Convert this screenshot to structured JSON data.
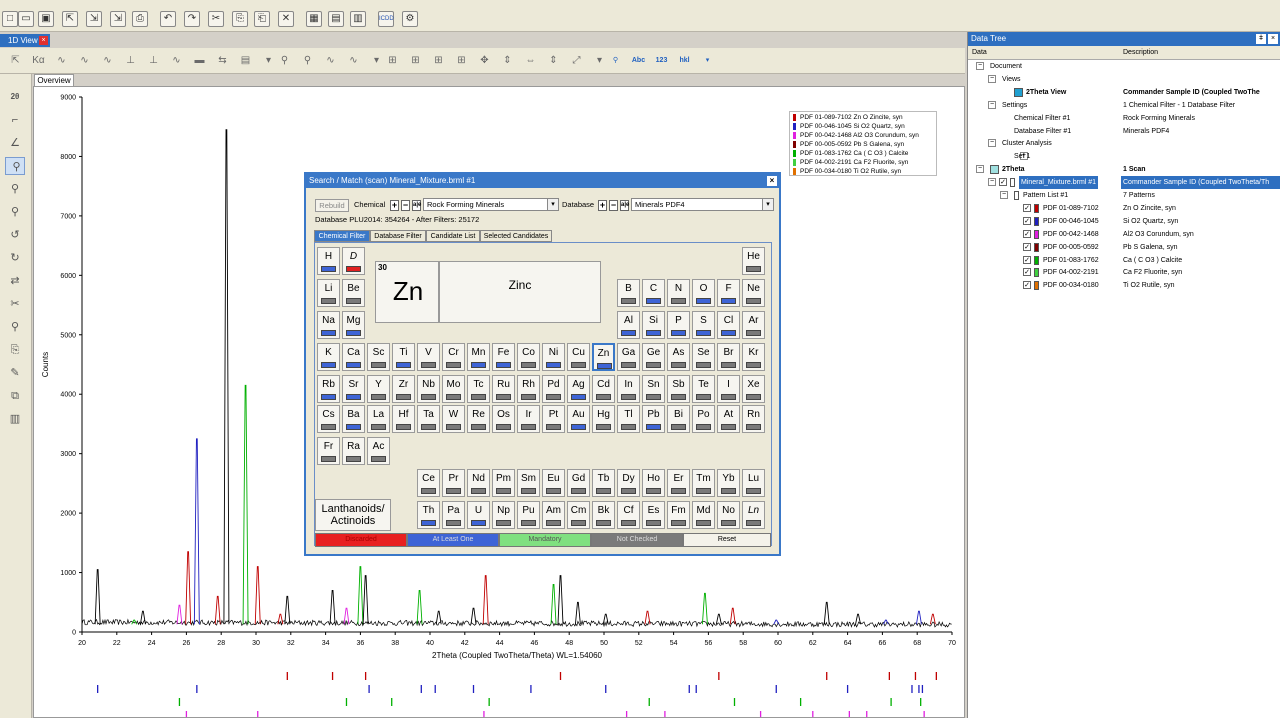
{
  "toolbar": {
    "icons": [
      "new-icon",
      "open-icon",
      "save-icon",
      "export-icon",
      "import-icon",
      "import-multi-icon",
      "print-icon",
      "undo-icon",
      "redo-icon",
      "cut-icon",
      "copy-icon",
      "paste-icon",
      "delete-icon",
      "view1-icon",
      "view2-icon",
      "view3-icon",
      "icdd-icon",
      "settings-icon"
    ],
    "icdd_label": "ICDD"
  },
  "view_tab": {
    "label": "1D View"
  },
  "overview_tab": {
    "label": "Overview"
  },
  "chart_data": {
    "type": "line",
    "xlabel": "2Theta (Coupled TwoTheta/Theta) WL=1.54060",
    "ylabel": "Counts",
    "xlim": [
      20,
      70
    ],
    "ylim": [
      0,
      9000
    ],
    "x_ticks": [
      "20",
      "22",
      "24",
      "26",
      "28",
      "30",
      "32",
      "34",
      "36",
      "38",
      "40",
      "42",
      "44",
      "46",
      "48",
      "50",
      "52",
      "54",
      "56",
      "58",
      "60",
      "62",
      "64",
      "66",
      "68",
      "70"
    ],
    "y_ticks": [
      "0",
      "1000",
      "2000",
      "3000",
      "4000",
      "5000",
      "6000",
      "7000",
      "8000",
      "9000"
    ],
    "peaks": [
      {
        "x": 20.9,
        "y": 1050,
        "color": "#000000"
      },
      {
        "x": 23.0,
        "y": 200,
        "color": "#00b000"
      },
      {
        "x": 23.5,
        "y": 350,
        "color": "#000000"
      },
      {
        "x": 25.6,
        "y": 450,
        "color": "#e020e0"
      },
      {
        "x": 26.1,
        "y": 1350,
        "color": "#c00000"
      },
      {
        "x": 26.6,
        "y": 3250,
        "color": "#2020c0"
      },
      {
        "x": 27.8,
        "y": 600,
        "color": "#c00000"
      },
      {
        "x": 28.3,
        "y": 8450,
        "color": "#000000"
      },
      {
        "x": 29.4,
        "y": 4150,
        "color": "#00b000"
      },
      {
        "x": 30.1,
        "y": 1100,
        "color": "#c00000"
      },
      {
        "x": 31.4,
        "y": 300,
        "color": "#c00000"
      },
      {
        "x": 31.8,
        "y": 600,
        "color": "#000000"
      },
      {
        "x": 34.4,
        "y": 700,
        "color": "#000000"
      },
      {
        "x": 35.2,
        "y": 400,
        "color": "#e020e0"
      },
      {
        "x": 36.0,
        "y": 1100,
        "color": "#00b000"
      },
      {
        "x": 36.3,
        "y": 950,
        "color": "#000000"
      },
      {
        "x": 39.4,
        "y": 700,
        "color": "#00b000"
      },
      {
        "x": 40.5,
        "y": 350,
        "color": "#000000"
      },
      {
        "x": 42.5,
        "y": 400,
        "color": "#000000"
      },
      {
        "x": 43.2,
        "y": 950,
        "color": "#c00000"
      },
      {
        "x": 47.1,
        "y": 800,
        "color": "#00b000"
      },
      {
        "x": 47.5,
        "y": 950,
        "color": "#000000"
      },
      {
        "x": 48.5,
        "y": 500,
        "color": "#000000"
      },
      {
        "x": 50.1,
        "y": 300,
        "color": "#000000"
      },
      {
        "x": 52.5,
        "y": 350,
        "color": "#c00000"
      },
      {
        "x": 55.8,
        "y": 650,
        "color": "#00b000"
      },
      {
        "x": 56.6,
        "y": 300,
        "color": "#000000"
      },
      {
        "x": 57.4,
        "y": 400,
        "color": "#c00000"
      },
      {
        "x": 59.9,
        "y": 200,
        "color": "#2020c0"
      },
      {
        "x": 62.8,
        "y": 500,
        "color": "#000000"
      },
      {
        "x": 64.6,
        "y": 300,
        "color": "#000000"
      },
      {
        "x": 66.2,
        "y": 200,
        "color": "#2020c0"
      },
      {
        "x": 68.1,
        "y": 350,
        "color": "#2020c0"
      },
      {
        "x": 68.9,
        "y": 300,
        "color": "#c00000"
      }
    ],
    "stick_patterns": [
      {
        "color": "#c00000",
        "x": [
          31.8,
          34.4,
          36.3,
          47.5,
          56.6,
          62.8,
          66.4,
          67.9,
          69.1
        ]
      },
      {
        "color": "#2020c0",
        "x": [
          20.9,
          26.6,
          36.5,
          39.5,
          40.3,
          42.5,
          45.8,
          50.1,
          54.9,
          55.3,
          59.9,
          64.0,
          67.7,
          68.1,
          68.3
        ]
      },
      {
        "color": "#00b000",
        "x": [
          25.6,
          35.2,
          37.8,
          43.4,
          52.6,
          57.5,
          61.3,
          66.5,
          68.2
        ]
      },
      {
        "color": "#e020e0",
        "x": [
          26.0,
          30.1,
          43.1,
          51.3,
          53.5,
          59.0,
          62.0,
          64.1,
          65.1,
          68.4
        ]
      },
      {
        "color": "#c00000",
        "x": [
          23.1,
          29.4,
          36.0,
          39.4,
          43.2,
          47.1,
          47.5,
          48.5,
          57.4,
          60.7,
          61.4,
          64.7,
          65.6,
          69.2
        ]
      },
      {
        "color": "#e07000",
        "x": [
          28.3,
          47.0,
          55.8,
          58.6,
          69.5
        ]
      }
    ],
    "legend": [
      {
        "label": "PDF 01-089-7102 Zn O Zincite, syn",
        "color": "#c00000"
      },
      {
        "label": "PDF 00-046-1045 Si O2 Quartz, syn",
        "color": "#2020c0"
      },
      {
        "label": "PDF 00-042-1468 Al2 O3 Corundum, syn",
        "color": "#e020e0"
      },
      {
        "label": "PDF 00-005-0592 Pb S Galena, syn",
        "color": "#800000"
      },
      {
        "label": "PDF 01-083-1762 Ca ( C O3 ) Calcite",
        "color": "#00b000"
      },
      {
        "label": "PDF 04-002-2191 Ca F2 Fluorite, syn",
        "color": "#40d040"
      },
      {
        "label": "PDF 00-034-0180 Ti O2 Rutile, syn",
        "color": "#e07000"
      }
    ]
  },
  "datatree": {
    "title": "Data Tree",
    "col_data": "Data",
    "col_desc": "Description",
    "rows": [
      {
        "label": "Document",
        "desc": "",
        "indent": 0
      },
      {
        "label": "Views",
        "desc": "",
        "indent": 1
      },
      {
        "label": "2Theta View",
        "desc": "Commander Sample ID (Coupled TwoThe",
        "indent": 2,
        "bold": true
      },
      {
        "label": "Settings",
        "desc": "1 Chemical Filter - 1 Database Filter",
        "indent": 1
      },
      {
        "label": "Chemical Filter #1",
        "desc": "Rock Forming Minerals",
        "indent": 2
      },
      {
        "label": "Database Filter #1",
        "desc": "Minerals PDF4",
        "indent": 2
      },
      {
        "label": "Cluster Analysis",
        "desc": "",
        "indent": 1
      },
      {
        "label": "Set 1",
        "desc": "",
        "indent": 2
      },
      {
        "label": "2Theta",
        "desc": "1 Scan",
        "indent": 0,
        "bold": true
      },
      {
        "label": "Mineral_Mixture.brml #1",
        "desc": "Commander Sample ID (Coupled TwoTheta/Th",
        "indent": 1,
        "hl": true
      },
      {
        "label": "Pattern List #1",
        "desc": "7 Patterns",
        "indent": 2
      },
      {
        "label": "PDF 01-089-7102",
        "desc": "Zn O Zincite, syn",
        "indent": 3,
        "color": "#c00000"
      },
      {
        "label": "PDF 00-046-1045",
        "desc": "Si O2 Quartz, syn",
        "indent": 3,
        "color": "#2020c0"
      },
      {
        "label": "PDF 00-042-1468",
        "desc": "Al2 O3 Corundum, syn",
        "indent": 3,
        "color": "#e020e0"
      },
      {
        "label": "PDF 00-005-0592",
        "desc": "Pb S Galena, syn",
        "indent": 3,
        "color": "#800000"
      },
      {
        "label": "PDF 01-083-1762",
        "desc": "Ca ( C O3 ) Calcite",
        "indent": 3,
        "color": "#00b000"
      },
      {
        "label": "PDF 04-002-2191",
        "desc": "Ca F2 Fluorite, syn",
        "indent": 3,
        "color": "#40d040"
      },
      {
        "label": "PDF 00-034-0180",
        "desc": "Ti O2 Rutile, syn",
        "indent": 3,
        "color": "#e07000"
      }
    ]
  },
  "dialog": {
    "title": "Search / Match (scan) Mineral_Mixture.brml #1",
    "rebuild": "Rebuild",
    "chemical_label": "Chemical",
    "chemical_value": "Rock Forming Minerals",
    "database_label": "Database",
    "database_value": "Minerals PDF4",
    "db_info": "Database PLU2014: 354264 - After Filters: 25172",
    "tabs": [
      "Chemical Filter",
      "Database Filter",
      "Candidate List",
      "Selected Candidates"
    ],
    "selected_element": {
      "number": "30",
      "symbol": "Zn",
      "name": "Zinc"
    },
    "lanthanoids": "Lanthanoids/ Actinoids",
    "legend": [
      {
        "label": "Discarded",
        "color": "#e82020"
      },
      {
        "label": "At Least One",
        "color": "#3e64d6"
      },
      {
        "label": "Mandatory",
        "color": "#80e080"
      },
      {
        "label": "Not Checked",
        "color": "#7a7a7a"
      }
    ],
    "reset": "Reset",
    "elements": [
      {
        "s": "H",
        "r": 0,
        "c": 0,
        "st": "b"
      },
      {
        "s": "D",
        "r": 0,
        "c": 1,
        "st": "r",
        "it": true
      },
      {
        "s": "He",
        "r": 0,
        "c": 17,
        "st": "g"
      },
      {
        "s": "Li",
        "r": 1,
        "c": 0,
        "st": "g"
      },
      {
        "s": "Be",
        "r": 1,
        "c": 1,
        "st": "g"
      },
      {
        "s": "B",
        "r": 1,
        "c": 12,
        "st": "g"
      },
      {
        "s": "C",
        "r": 1,
        "c": 13,
        "st": "b"
      },
      {
        "s": "N",
        "r": 1,
        "c": 14,
        "st": "g"
      },
      {
        "s": "O",
        "r": 1,
        "c": 15,
        "st": "b"
      },
      {
        "s": "F",
        "r": 1,
        "c": 16,
        "st": "b"
      },
      {
        "s": "Ne",
        "r": 1,
        "c": 17,
        "st": "g"
      },
      {
        "s": "Na",
        "r": 2,
        "c": 0,
        "st": "b"
      },
      {
        "s": "Mg",
        "r": 2,
        "c": 1,
        "st": "b"
      },
      {
        "s": "Al",
        "r": 2,
        "c": 12,
        "st": "b"
      },
      {
        "s": "Si",
        "r": 2,
        "c": 13,
        "st": "b"
      },
      {
        "s": "P",
        "r": 2,
        "c": 14,
        "st": "b"
      },
      {
        "s": "S",
        "r": 2,
        "c": 15,
        "st": "b"
      },
      {
        "s": "Cl",
        "r": 2,
        "c": 16,
        "st": "b"
      },
      {
        "s": "Ar",
        "r": 2,
        "c": 17,
        "st": "g"
      },
      {
        "s": "K",
        "r": 3,
        "c": 0,
        "st": "b"
      },
      {
        "s": "Ca",
        "r": 3,
        "c": 1,
        "st": "b"
      },
      {
        "s": "Sc",
        "r": 3,
        "c": 2,
        "st": "g"
      },
      {
        "s": "Ti",
        "r": 3,
        "c": 3,
        "st": "b"
      },
      {
        "s": "V",
        "r": 3,
        "c": 4,
        "st": "g"
      },
      {
        "s": "Cr",
        "r": 3,
        "c": 5,
        "st": "g"
      },
      {
        "s": "Mn",
        "r": 3,
        "c": 6,
        "st": "b"
      },
      {
        "s": "Fe",
        "r": 3,
        "c": 7,
        "st": "b"
      },
      {
        "s": "Co",
        "r": 3,
        "c": 8,
        "st": "g"
      },
      {
        "s": "Ni",
        "r": 3,
        "c": 9,
        "st": "b"
      },
      {
        "s": "Cu",
        "r": 3,
        "c": 10,
        "st": "g"
      },
      {
        "s": "Zn",
        "r": 3,
        "c": 11,
        "st": "b",
        "zn": true
      },
      {
        "s": "Ga",
        "r": 3,
        "c": 12,
        "st": "g"
      },
      {
        "s": "Ge",
        "r": 3,
        "c": 13,
        "st": "g"
      },
      {
        "s": "As",
        "r": 3,
        "c": 14,
        "st": "g"
      },
      {
        "s": "Se",
        "r": 3,
        "c": 15,
        "st": "g"
      },
      {
        "s": "Br",
        "r": 3,
        "c": 16,
        "st": "g"
      },
      {
        "s": "Kr",
        "r": 3,
        "c": 17,
        "st": "g"
      },
      {
        "s": "Rb",
        "r": 4,
        "c": 0,
        "st": "b"
      },
      {
        "s": "Sr",
        "r": 4,
        "c": 1,
        "st": "b"
      },
      {
        "s": "Y",
        "r": 4,
        "c": 2,
        "st": "g"
      },
      {
        "s": "Zr",
        "r": 4,
        "c": 3,
        "st": "g"
      },
      {
        "s": "Nb",
        "r": 4,
        "c": 4,
        "st": "g"
      },
      {
        "s": "Mo",
        "r": 4,
        "c": 5,
        "st": "g"
      },
      {
        "s": "Tc",
        "r": 4,
        "c": 6,
        "st": "g"
      },
      {
        "s": "Ru",
        "r": 4,
        "c": 7,
        "st": "g"
      },
      {
        "s": "Rh",
        "r": 4,
        "c": 8,
        "st": "g"
      },
      {
        "s": "Pd",
        "r": 4,
        "c": 9,
        "st": "g"
      },
      {
        "s": "Ag",
        "r": 4,
        "c": 10,
        "st": "b"
      },
      {
        "s": "Cd",
        "r": 4,
        "c": 11,
        "st": "g"
      },
      {
        "s": "In",
        "r": 4,
        "c": 12,
        "st": "g"
      },
      {
        "s": "Sn",
        "r": 4,
        "c": 13,
        "st": "g"
      },
      {
        "s": "Sb",
        "r": 4,
        "c": 14,
        "st": "g"
      },
      {
        "s": "Te",
        "r": 4,
        "c": 15,
        "st": "g"
      },
      {
        "s": "I",
        "r": 4,
        "c": 16,
        "st": "g"
      },
      {
        "s": "Xe",
        "r": 4,
        "c": 17,
        "st": "g"
      },
      {
        "s": "Cs",
        "r": 5,
        "c": 0,
        "st": "g"
      },
      {
        "s": "Ba",
        "r": 5,
        "c": 1,
        "st": "b"
      },
      {
        "s": "La",
        "r": 5,
        "c": 2,
        "st": "g"
      },
      {
        "s": "Hf",
        "r": 5,
        "c": 3,
        "st": "g"
      },
      {
        "s": "Ta",
        "r": 5,
        "c": 4,
        "st": "g"
      },
      {
        "s": "W",
        "r": 5,
        "c": 5,
        "st": "g"
      },
      {
        "s": "Re",
        "r": 5,
        "c": 6,
        "st": "g"
      },
      {
        "s": "Os",
        "r": 5,
        "c": 7,
        "st": "g"
      },
      {
        "s": "Ir",
        "r": 5,
        "c": 8,
        "st": "g"
      },
      {
        "s": "Pt",
        "r": 5,
        "c": 9,
        "st": "g"
      },
      {
        "s": "Au",
        "r": 5,
        "c": 10,
        "st": "b"
      },
      {
        "s": "Hg",
        "r": 5,
        "c": 11,
        "st": "g"
      },
      {
        "s": "Tl",
        "r": 5,
        "c": 12,
        "st": "g"
      },
      {
        "s": "Pb",
        "r": 5,
        "c": 13,
        "st": "b"
      },
      {
        "s": "Bi",
        "r": 5,
        "c": 14,
        "st": "g"
      },
      {
        "s": "Po",
        "r": 5,
        "c": 15,
        "st": "g"
      },
      {
        "s": "At",
        "r": 5,
        "c": 16,
        "st": "g"
      },
      {
        "s": "Rn",
        "r": 5,
        "c": 17,
        "st": "g"
      },
      {
        "s": "Fr",
        "r": 6,
        "c": 0,
        "st": "g"
      },
      {
        "s": "Ra",
        "r": 6,
        "c": 1,
        "st": "g"
      },
      {
        "s": "Ac",
        "r": 6,
        "c": 2,
        "st": "g"
      },
      {
        "s": "Ce",
        "r": 7,
        "c": 4,
        "st": "g"
      },
      {
        "s": "Pr",
        "r": 7,
        "c": 5,
        "st": "g"
      },
      {
        "s": "Nd",
        "r": 7,
        "c": 6,
        "st": "g"
      },
      {
        "s": "Pm",
        "r": 7,
        "c": 7,
        "st": "g"
      },
      {
        "s": "Sm",
        "r": 7,
        "c": 8,
        "st": "g"
      },
      {
        "s": "Eu",
        "r": 7,
        "c": 9,
        "st": "g"
      },
      {
        "s": "Gd",
        "r": 7,
        "c": 10,
        "st": "g"
      },
      {
        "s": "Tb",
        "r": 7,
        "c": 11,
        "st": "g"
      },
      {
        "s": "Dy",
        "r": 7,
        "c": 12,
        "st": "g"
      },
      {
        "s": "Ho",
        "r": 7,
        "c": 13,
        "st": "g"
      },
      {
        "s": "Er",
        "r": 7,
        "c": 14,
        "st": "g"
      },
      {
        "s": "Tm",
        "r": 7,
        "c": 15,
        "st": "g"
      },
      {
        "s": "Yb",
        "r": 7,
        "c": 16,
        "st": "g"
      },
      {
        "s": "Lu",
        "r": 7,
        "c": 17,
        "st": "g"
      },
      {
        "s": "Th",
        "r": 8,
        "c": 4,
        "st": "b"
      },
      {
        "s": "Pa",
        "r": 8,
        "c": 5,
        "st": "g"
      },
      {
        "s": "U",
        "r": 8,
        "c": 6,
        "st": "b"
      },
      {
        "s": "Np",
        "r": 8,
        "c": 7,
        "st": "g"
      },
      {
        "s": "Pu",
        "r": 8,
        "c": 8,
        "st": "g"
      },
      {
        "s": "Am",
        "r": 8,
        "c": 9,
        "st": "g"
      },
      {
        "s": "Cm",
        "r": 8,
        "c": 10,
        "st": "g"
      },
      {
        "s": "Bk",
        "r": 8,
        "c": 11,
        "st": "g"
      },
      {
        "s": "Cf",
        "r": 8,
        "c": 12,
        "st": "g"
      },
      {
        "s": "Es",
        "r": 8,
        "c": 13,
        "st": "g"
      },
      {
        "s": "Fm",
        "r": 8,
        "c": 14,
        "st": "g"
      },
      {
        "s": "Md",
        "r": 8,
        "c": 15,
        "st": "g"
      },
      {
        "s": "No",
        "r": 8,
        "c": 16,
        "st": "g"
      },
      {
        "s": "Ln",
        "r": 8,
        "c": 17,
        "st": "g",
        "it": true
      }
    ]
  }
}
